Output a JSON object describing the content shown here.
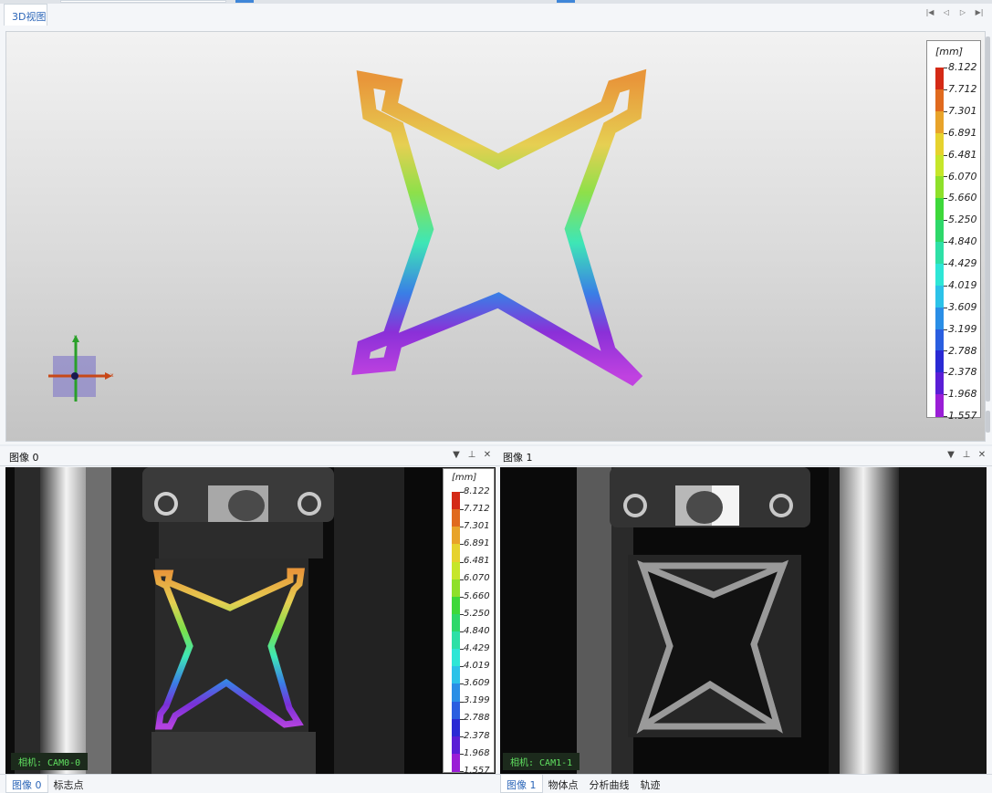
{
  "top_panel": {
    "tab_label": "3D视图",
    "nav_icons": [
      "first-icon",
      "previous-icon",
      "next-icon",
      "last-icon"
    ]
  },
  "legend": {
    "unit": "[mm]",
    "values": [
      "8.122",
      "7.712",
      "7.301",
      "6.891",
      "6.481",
      "6.070",
      "5.660",
      "5.250",
      "4.840",
      "4.429",
      "4.019",
      "3.609",
      "3.199",
      "2.788",
      "2.378",
      "1.968",
      "1.557"
    ],
    "colors": [
      "#d42a16",
      "#e06a1e",
      "#e8a32a",
      "#e6d22e",
      "#c6e62a",
      "#8ee02a",
      "#3ed83a",
      "#2ed86a",
      "#2ee0a6",
      "#2ee6d6",
      "#2cc2e8",
      "#2a8ee6",
      "#2a5ee0",
      "#2a2ad4",
      "#5a1ed6",
      "#9a1ed6",
      "#c21ed0"
    ]
  },
  "panel0": {
    "title": "图像 0",
    "camera_label": "相机: CAM0-0",
    "tabs": [
      {
        "label": "图像 0",
        "active": true
      },
      {
        "label": "标志点",
        "active": false
      }
    ]
  },
  "panel1": {
    "title": "图像 1",
    "camera_label": "相机: CAM1-1",
    "tabs": [
      {
        "label": "图像 1",
        "active": true
      },
      {
        "label": "物体点",
        "active": false
      },
      {
        "label": "分析曲线",
        "active": false
      },
      {
        "label": "轨迹",
        "active": false
      }
    ]
  },
  "panel_controls": [
    "dropdown-icon",
    "pin-icon",
    "close-icon"
  ],
  "colors": {
    "accent": "#2c66b8",
    "camera_text": "#60e060"
  }
}
